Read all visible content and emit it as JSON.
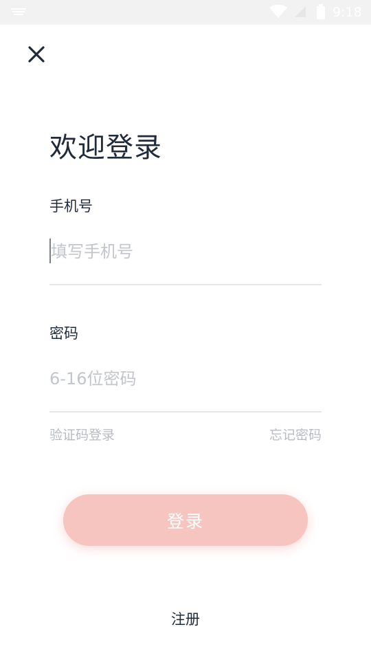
{
  "status_bar": {
    "time": "9:18"
  },
  "title": "欢迎登录",
  "phone": {
    "label": "手机号",
    "placeholder": "填写手机号",
    "value": ""
  },
  "password": {
    "label": "密码",
    "placeholder": "6-16位密码",
    "value": ""
  },
  "links": {
    "sms_login": "验证码登录",
    "forgot_password": "忘记密码"
  },
  "login_button": {
    "label": "登录"
  },
  "register_link": {
    "label": "注册"
  },
  "colors": {
    "status_bar_bg": "#f2f2f2",
    "text_primary": "#1f2a3a",
    "placeholder": "#c2c5ca",
    "link": "#b7bbc1",
    "login_button_bg": "#f7c5c0",
    "divider": "#e6e6e8"
  },
  "icons": {
    "close": "close-icon",
    "wifi": "wifi-icon",
    "signal": "cell-signal-icon",
    "battery": "battery-icon",
    "notification": "notification-icon"
  }
}
